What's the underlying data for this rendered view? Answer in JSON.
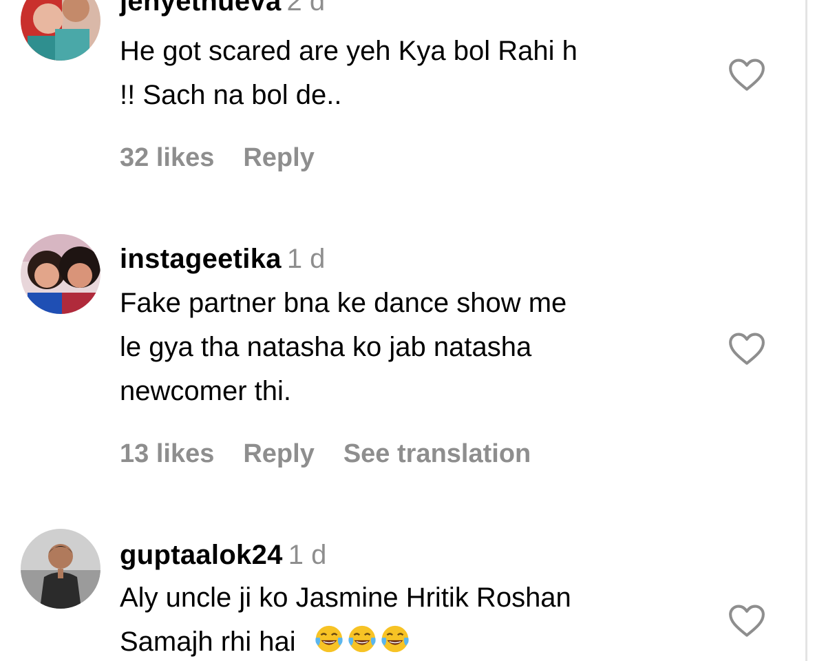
{
  "comments": [
    {
      "username": "jenyetnueva",
      "time": "2 d",
      "text_lines": [
        "He got scared are yeh Kya bol Rahi h",
        "!! Sach na bol de.."
      ],
      "likes": "32 likes",
      "reply": "Reply"
    },
    {
      "username": "instageetika",
      "time": "1 d",
      "text_lines": [
        "Fake partner bna ke dance show me",
        "le gya tha natasha ko jab natasha",
        "newcomer thi."
      ],
      "likes": "13 likes",
      "reply": "Reply",
      "translate": "See translation"
    },
    {
      "username": "guptaalok24",
      "time": "1 d",
      "text_lines": [
        "Aly uncle ji ko Jasmine Hritik Roshan",
        "Samajh rhi hai"
      ],
      "emoji": [
        "face-with-tears-of-joy-emoji",
        "face-with-tears-of-joy-emoji",
        "face-with-tears-of-joy-emoji"
      ]
    }
  ],
  "colors": {
    "text": "#000000",
    "muted": "#8e8e8e",
    "heart_outline": "#8e8e8e"
  },
  "icons": {
    "like": "heart-outline-icon"
  }
}
